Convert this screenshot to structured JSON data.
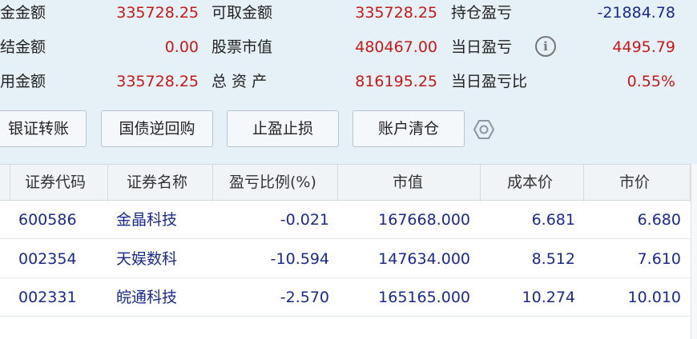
{
  "summary": {
    "col1": [
      {
        "label": "金金额",
        "value": "335728.25"
      },
      {
        "label": "结金额",
        "value": "0.00"
      },
      {
        "label": "用金额",
        "value": "335728.25"
      }
    ],
    "col2": [
      {
        "label": "可取金额",
        "value": "335728.25"
      },
      {
        "label": "股票市值",
        "value": "480467.00"
      },
      {
        "label": "总 资 产",
        "value": "816195.25"
      }
    ],
    "col3": [
      {
        "label": "持仓盈亏",
        "value": "-21884.78"
      },
      {
        "label": "当日盈亏",
        "value": "4495.79"
      },
      {
        "label": "当日盈亏比",
        "value": "0.55%"
      }
    ],
    "info_glyph": "i"
  },
  "buttons": {
    "transfer": "银证转账",
    "repo": "国债逆回购",
    "stop": "止盈止损",
    "clear": "账户清仓"
  },
  "table": {
    "headers": [
      "证券代码",
      "证券名称",
      "盈亏比例(%)",
      "市值",
      "成本价",
      "市价"
    ],
    "rows": [
      [
        "600586",
        "金晶科技",
        "-0.021",
        "167668.000",
        "6.681",
        "6.680"
      ],
      [
        "002354",
        "天娱数科",
        "-10.594",
        "147634.000",
        "8.512",
        "7.610"
      ],
      [
        "002331",
        "皖通科技",
        "-2.570",
        "165165.000",
        "10.274",
        "10.010"
      ]
    ]
  },
  "colors": {
    "accent_red": "#c41a1a",
    "accent_blue": "#1a2a8c",
    "background": "#e6f0f7"
  },
  "icons": [
    "info-icon",
    "settings-gear-icon"
  ]
}
